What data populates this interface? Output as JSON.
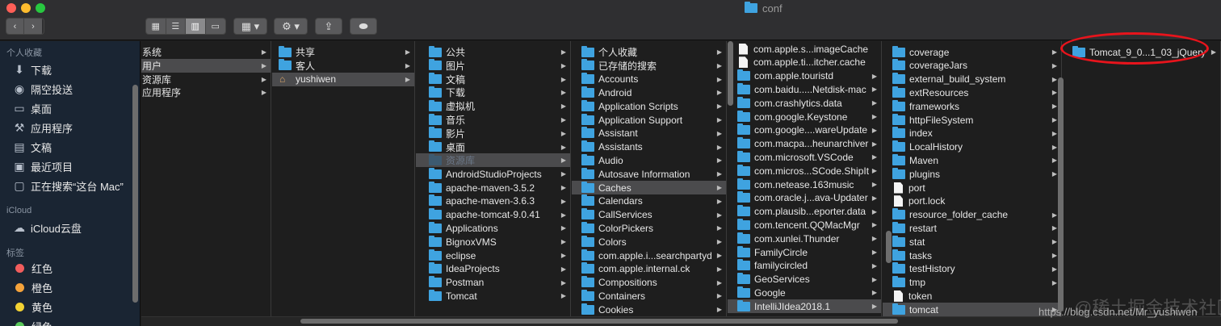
{
  "window": {
    "title": "conf"
  },
  "toolbar": {
    "back_glyph": "‹",
    "forward_glyph": "›",
    "view_icons": "▦",
    "view_list": "☰",
    "view_columns": "▥",
    "view_gallery": "▭",
    "group_glyph": "▦ ▾",
    "action_glyph": "⚙ ▾",
    "share_glyph": "⇪",
    "tag_glyph": "⬬"
  },
  "sidebar": {
    "favorites_header": "个人收藏",
    "favorites": [
      {
        "label": "下载",
        "icon": "⬇"
      },
      {
        "label": "隔空投送",
        "icon": "◉"
      },
      {
        "label": "桌面",
        "icon": "▭"
      },
      {
        "label": "应用程序",
        "icon": "⚒"
      },
      {
        "label": "文稿",
        "icon": "▤"
      },
      {
        "label": "最近项目",
        "icon": "▣"
      },
      {
        "label": "正在搜索“这台 Mac”",
        "icon": "▢"
      }
    ],
    "icloud_header": "iCloud",
    "icloud": [
      {
        "label": "iCloud云盘",
        "icon": "☁"
      }
    ],
    "tags_header": "标签",
    "tags": [
      {
        "label": "红色",
        "color": "#f25d5d"
      },
      {
        "label": "橙色",
        "color": "#f5a33b"
      },
      {
        "label": "黄色",
        "color": "#f3d233"
      },
      {
        "label": "绿色",
        "color": "#5bc95b"
      }
    ]
  },
  "columns": [
    {
      "items": [
        {
          "label": "系统",
          "kind": "folder",
          "chevron": true
        },
        {
          "label": "用户",
          "kind": "folder",
          "chevron": true,
          "selected": true
        },
        {
          "label": "资源库",
          "kind": "folder",
          "chevron": true
        },
        {
          "label": "应用程序",
          "kind": "folder",
          "chevron": true
        }
      ]
    },
    {
      "items": [
        {
          "label": "共享",
          "kind": "folder",
          "chevron": true
        },
        {
          "label": "客人",
          "kind": "folder",
          "chevron": true
        },
        {
          "label": "yushiwen",
          "kind": "home",
          "chevron": true,
          "selected": true
        }
      ]
    },
    {
      "items": [
        {
          "label": "公共",
          "kind": "folder",
          "chevron": true
        },
        {
          "label": "图片",
          "kind": "folder",
          "chevron": true
        },
        {
          "label": "文稿",
          "kind": "folder",
          "chevron": true
        },
        {
          "label": "下载",
          "kind": "folder",
          "chevron": true
        },
        {
          "label": "虚拟机",
          "kind": "folder",
          "chevron": true
        },
        {
          "label": "音乐",
          "kind": "folder",
          "chevron": true
        },
        {
          "label": "影片",
          "kind": "folder",
          "chevron": true
        },
        {
          "label": "桌面",
          "kind": "folder",
          "chevron": true
        },
        {
          "label": "资源库",
          "kind": "folder",
          "chevron": true,
          "selected": true,
          "dim": true
        },
        {
          "label": "AndroidStudioProjects",
          "kind": "folder",
          "chevron": true
        },
        {
          "label": "apache-maven-3.5.2",
          "kind": "folder",
          "chevron": true
        },
        {
          "label": "apache-maven-3.6.3",
          "kind": "folder",
          "chevron": true
        },
        {
          "label": "apache-tomcat-9.0.41",
          "kind": "folder",
          "chevron": true
        },
        {
          "label": "Applications",
          "kind": "folder",
          "chevron": true
        },
        {
          "label": "BignoxVMS",
          "kind": "folder",
          "chevron": true
        },
        {
          "label": "eclipse",
          "kind": "folder",
          "chevron": true
        },
        {
          "label": "IdeaProjects",
          "kind": "folder",
          "chevron": true
        },
        {
          "label": "Postman",
          "kind": "folder",
          "chevron": true
        },
        {
          "label": "Tomcat",
          "kind": "folder",
          "chevron": true
        }
      ]
    },
    {
      "items": [
        {
          "label": "个人收藏",
          "kind": "folder",
          "chevron": true
        },
        {
          "label": "已存储的搜索",
          "kind": "folder",
          "chevron": true
        },
        {
          "label": "Accounts",
          "kind": "folder",
          "chevron": true
        },
        {
          "label": "Android",
          "kind": "folder",
          "chevron": true
        },
        {
          "label": "Application Scripts",
          "kind": "folder",
          "chevron": true
        },
        {
          "label": "Application Support",
          "kind": "folder",
          "chevron": true
        },
        {
          "label": "Assistant",
          "kind": "folder",
          "chevron": true
        },
        {
          "label": "Assistants",
          "kind": "folder",
          "chevron": true
        },
        {
          "label": "Audio",
          "kind": "folder",
          "chevron": true
        },
        {
          "label": "Autosave Information",
          "kind": "folder",
          "chevron": true
        },
        {
          "label": "Caches",
          "kind": "folder",
          "chevron": true,
          "selected": true
        },
        {
          "label": "Calendars",
          "kind": "folder",
          "chevron": true
        },
        {
          "label": "CallServices",
          "kind": "folder",
          "chevron": true
        },
        {
          "label": "ColorPickers",
          "kind": "folder",
          "chevron": true
        },
        {
          "label": "Colors",
          "kind": "folder",
          "chevron": true
        },
        {
          "label": "com.apple.i...searchpartyd",
          "kind": "folder",
          "chevron": true
        },
        {
          "label": "com.apple.internal.ck",
          "kind": "folder",
          "chevron": true
        },
        {
          "label": "Compositions",
          "kind": "folder",
          "chevron": true
        },
        {
          "label": "Containers",
          "kind": "folder",
          "chevron": true
        },
        {
          "label": "Cookies",
          "kind": "folder",
          "chevron": true
        }
      ]
    },
    {
      "items": [
        {
          "label": "com.apple.s...imageCache",
          "kind": "doc",
          "chevron": false
        },
        {
          "label": "com.apple.ti...itcher.cache",
          "kind": "doc",
          "chevron": false
        },
        {
          "label": "com.apple.touristd",
          "kind": "folder",
          "chevron": true
        },
        {
          "label": "com.baidu.....Netdisk-mac",
          "kind": "folder",
          "chevron": true
        },
        {
          "label": "com.crashlytics.data",
          "kind": "folder",
          "chevron": true
        },
        {
          "label": "com.google.Keystone",
          "kind": "folder",
          "chevron": true
        },
        {
          "label": "com.google....wareUpdate",
          "kind": "folder",
          "chevron": true
        },
        {
          "label": "com.macpa...heunarchiver",
          "kind": "folder",
          "chevron": true
        },
        {
          "label": "com.microsoft.VSCode",
          "kind": "folder",
          "chevron": true
        },
        {
          "label": "com.micros...SCode.ShipIt",
          "kind": "folder",
          "chevron": true
        },
        {
          "label": "com.netease.163music",
          "kind": "folder",
          "chevron": true
        },
        {
          "label": "com.oracle.j...ava-Updater",
          "kind": "folder",
          "chevron": true
        },
        {
          "label": "com.plausib...eporter.data",
          "kind": "folder",
          "chevron": true
        },
        {
          "label": "com.tencent.QQMacMgr",
          "kind": "folder",
          "chevron": true
        },
        {
          "label": "com.xunlei.Thunder",
          "kind": "folder",
          "chevron": true
        },
        {
          "label": "FamilyCircle",
          "kind": "folder",
          "chevron": true
        },
        {
          "label": "familycircled",
          "kind": "folder",
          "chevron": true
        },
        {
          "label": "GeoServices",
          "kind": "folder",
          "chevron": true
        },
        {
          "label": "Google",
          "kind": "folder",
          "chevron": true
        },
        {
          "label": "IntelliJIdea2018.1",
          "kind": "folder",
          "chevron": true,
          "selected": true
        }
      ]
    },
    {
      "items": [
        {
          "label": "coverage",
          "kind": "folder",
          "chevron": true
        },
        {
          "label": "coverageJars",
          "kind": "folder",
          "chevron": true
        },
        {
          "label": "external_build_system",
          "kind": "folder",
          "chevron": true
        },
        {
          "label": "extResources",
          "kind": "folder",
          "chevron": true
        },
        {
          "label": "frameworks",
          "kind": "folder",
          "chevron": true
        },
        {
          "label": "httpFileSystem",
          "kind": "folder",
          "chevron": true
        },
        {
          "label": "index",
          "kind": "folder",
          "chevron": true
        },
        {
          "label": "LocalHistory",
          "kind": "folder",
          "chevron": true
        },
        {
          "label": "Maven",
          "kind": "folder",
          "chevron": true
        },
        {
          "label": "plugins",
          "kind": "folder",
          "chevron": true
        },
        {
          "label": "port",
          "kind": "doc",
          "chevron": false
        },
        {
          "label": "port.lock",
          "kind": "doc",
          "chevron": false
        },
        {
          "label": "resource_folder_cache",
          "kind": "folder",
          "chevron": true
        },
        {
          "label": "restart",
          "kind": "folder",
          "chevron": true
        },
        {
          "label": "stat",
          "kind": "folder",
          "chevron": true
        },
        {
          "label": "tasks",
          "kind": "folder",
          "chevron": true
        },
        {
          "label": "testHistory",
          "kind": "folder",
          "chevron": true
        },
        {
          "label": "tmp",
          "kind": "folder",
          "chevron": true
        },
        {
          "label": "token",
          "kind": "doc",
          "chevron": false
        },
        {
          "label": "tomcat",
          "kind": "folder",
          "chevron": true,
          "selected": true
        }
      ]
    },
    {
      "items": [
        {
          "label": "Tomcat_9_0...1_03_jQuery",
          "kind": "folder",
          "chevron": true
        }
      ]
    }
  ],
  "annotation": {
    "ring_color": "#e8141c"
  },
  "watermark": {
    "text": "https://blog.csdn.net/Mr_yushiwen",
    "overlay": "@稀土掘金技术社区"
  }
}
